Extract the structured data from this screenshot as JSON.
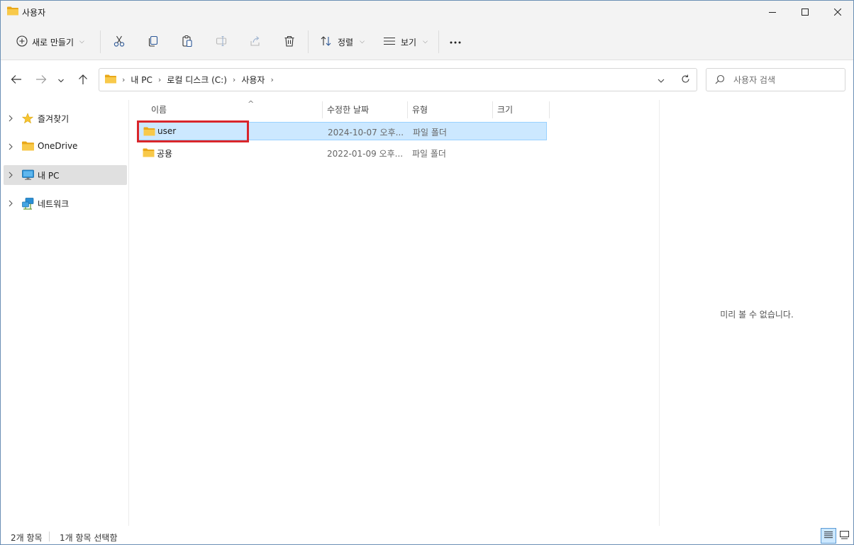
{
  "window": {
    "title": "사용자",
    "icons": {
      "folder": "folder-icon",
      "minimize": "minimize-icon",
      "maximize": "maximize-icon",
      "close": "close-icon"
    }
  },
  "commandbar": {
    "new_label": "새로 만들기",
    "sort_label": "정렬",
    "view_label": "보기",
    "more_label": "···",
    "icons": [
      "plus-circle-icon",
      "cut-icon",
      "copy-icon",
      "paste-icon",
      "rename-icon",
      "share-icon",
      "delete-icon",
      "sort-icon",
      "view-icon",
      "more-icon"
    ]
  },
  "address": {
    "crumbs": [
      "내 PC",
      "로컬 디스크 (C:)",
      "사용자"
    ],
    "search_placeholder": "사용자 검색"
  },
  "nav": {
    "items": [
      {
        "label": "즐겨찾기",
        "icon": "star-icon"
      },
      {
        "label": "OneDrive",
        "icon": "folder-icon"
      },
      {
        "label": "내 PC",
        "icon": "monitor-icon",
        "selected": true
      },
      {
        "label": "네트워크",
        "icon": "network-icon"
      }
    ]
  },
  "columns": {
    "name": "이름",
    "date": "수정한 날짜",
    "type": "유형",
    "size": "크기"
  },
  "rows": [
    {
      "name": "user",
      "date": "2024-10-07 오후...",
      "type": "파일 폴더",
      "selected": true
    },
    {
      "name": "공용",
      "date": "2022-01-09 오후...",
      "type": "파일 폴더",
      "selected": false
    }
  ],
  "preview": {
    "message": "미리 볼 수 없습니다."
  },
  "status": {
    "item_count": "2개 항목",
    "selected_count": "1개 항목 선택함"
  },
  "colors": {
    "selection": "#cce8ff",
    "selection_border": "#99d1ff",
    "highlight": "#d9262b",
    "folder": "#f5c342"
  }
}
